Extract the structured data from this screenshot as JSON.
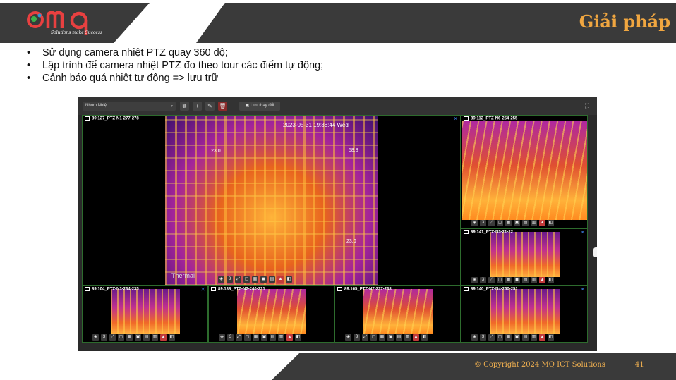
{
  "header": {
    "logo_text": "mq",
    "logo_tagline": "Solutions make Success",
    "title": "Giải pháp"
  },
  "bullets": [
    "Sử dụng camera nhiệt PTZ quay 360 độ;",
    "Lập trình để camera nhiệt PTZ đo theo tour các điểm tự động;",
    "Cảnh báo quá nhiệt tự động => lưu trữ"
  ],
  "app": {
    "group_select_value": "Nhóm Nhiệt",
    "save_label": "Lưu thay đổi",
    "icons": [
      "copy-icon",
      "plus-icon",
      "edit-icon",
      "delete-icon",
      "save-icon",
      "fullscreen-icon"
    ],
    "main_pane": {
      "title": "89.127_PTZ-N1-277-278",
      "timestamp": "2023-05-31 19:38:44 Wed",
      "temp_left": "23.0",
      "temp_right": "58.8",
      "temp_bottom": "23.0",
      "brand": "Thermal"
    },
    "side_panes": [
      {
        "title": "89.112_PTZ-N6-254-255"
      },
      {
        "title": "89.141_PTZ-N5-21-22"
      }
    ],
    "bottom_panes": [
      {
        "title": "89.104_PTZ-N3-234-235"
      },
      {
        "title": "89.138_PTZ-N2-240-231"
      },
      {
        "title": "89.165_PTZ-N7-237-238"
      },
      {
        "title": "89.140_PTZ-N4-260-251"
      }
    ],
    "close_glyph": "✕"
  },
  "footer": {
    "copyright": "© Copyright 2024 MQ ICT Solutions",
    "page_number": "41"
  },
  "colors": {
    "accent": "#f0a640",
    "dark_band": "#3a3a3a",
    "pane_border": "#2d6b2d"
  }
}
